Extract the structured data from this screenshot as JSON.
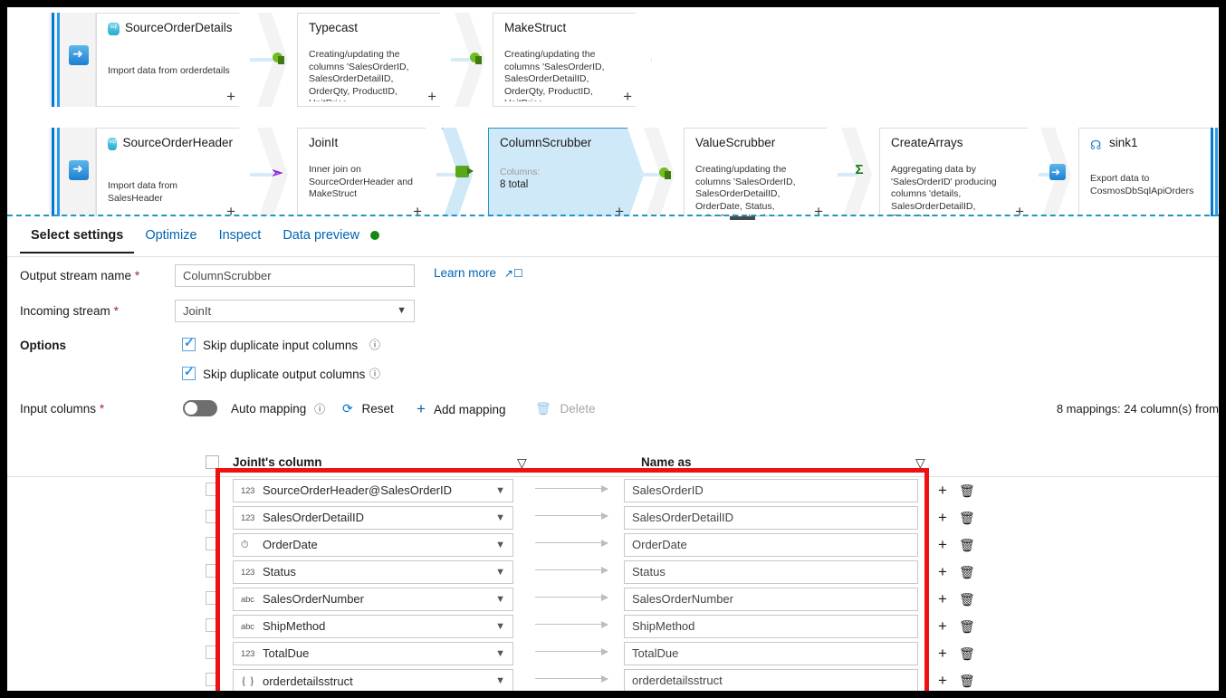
{
  "canvas": {
    "row1": [
      {
        "id": "source-order-details",
        "title": "SourceOrderDetails",
        "icon": "sql-database-icon",
        "desc": "Import data from orderdetails",
        "plus": "+"
      },
      {
        "id": "typecast",
        "title": "Typecast",
        "icon": "derived-column-icon",
        "desc": "Creating/updating the columns 'SalesOrderID, SalesOrderDetailID, OrderQty, ProductID, UnitPrice,",
        "plus": "+"
      },
      {
        "id": "make-struct",
        "title": "MakeStruct",
        "icon": "derived-column-icon",
        "desc": "Creating/updating the columns 'SalesOrderID, SalesOrderDetailID, OrderQty, ProductID, UnitPrice,",
        "plus": "+"
      }
    ],
    "row2": [
      {
        "id": "source-order-header",
        "title": "SourceOrderHeader",
        "icon": "sql-database-icon",
        "desc": "Import data from SalesHeader",
        "plus": "+"
      },
      {
        "id": "joinit",
        "title": "JoinIt",
        "icon": "join-icon",
        "desc": "Inner join on SourceOrderHeader and MakeStruct",
        "plus": "+"
      },
      {
        "id": "column-scrubber",
        "title": "ColumnScrubber",
        "icon": "select-icon",
        "label": "Columns:",
        "value": "8 total",
        "selected": true,
        "plus": "+"
      },
      {
        "id": "value-scrubber",
        "title": "ValueScrubber",
        "icon": "derived-column-icon",
        "desc": "Creating/updating the columns 'SalesOrderID, SalesOrderDetailID, OrderDate, Status, SalesOrderNumber,",
        "plus": "+"
      },
      {
        "id": "create-arrays",
        "title": "CreateArrays",
        "icon": "aggregate-icon",
        "desc": "Aggregating data by 'SalesOrderID' producing columns 'details, SalesOrderDetailID, OrderDate,",
        "plus": "+"
      },
      {
        "id": "sink1",
        "title": "sink1",
        "icon": "cosmos-db-icon",
        "desc": "Export data to CosmosDbSqlApiOrders",
        "plus": ""
      }
    ]
  },
  "tabs": [
    {
      "label": "Select settings",
      "active": true,
      "dot": false
    },
    {
      "label": "Optimize",
      "active": false,
      "dot": false
    },
    {
      "label": "Inspect",
      "active": false,
      "dot": false
    },
    {
      "label": "Data preview",
      "active": false,
      "dot": true
    }
  ],
  "form": {
    "output_stream_label": "Output stream name",
    "output_stream_value": "ColumnScrubber",
    "learn_more": "Learn more",
    "learn_more_icon": "external-link-icon",
    "incoming_stream_label": "Incoming stream",
    "incoming_stream_value": "JoinIt",
    "options_label": "Options",
    "option1": "Skip duplicate input columns",
    "option2": "Skip duplicate output columns",
    "input_columns_label": "Input columns",
    "required_marker": "*"
  },
  "toolbar": {
    "auto_mapping": "Auto mapping",
    "auto_mapping_on": false,
    "reset": "Reset",
    "add_mapping": "Add mapping",
    "delete": "Delete",
    "mapping_count": "8 mappings: 24 column(s) from"
  },
  "table": {
    "header_source": "JoinIt's column",
    "header_dest": "Name as",
    "rows": [
      {
        "type": "123",
        "source": "SourceOrderHeader@SalesOrderID",
        "dest": "SalesOrderID"
      },
      {
        "type": "123",
        "source": "SalesOrderDetailID",
        "dest": "SalesOrderDetailID"
      },
      {
        "type": "date",
        "source": "OrderDate",
        "dest": "OrderDate"
      },
      {
        "type": "123",
        "source": "Status",
        "dest": "Status"
      },
      {
        "type": "abc",
        "source": "SalesOrderNumber",
        "dest": "SalesOrderNumber"
      },
      {
        "type": "abc",
        "source": "ShipMethod",
        "dest": "ShipMethod"
      },
      {
        "type": "123",
        "source": "TotalDue",
        "dest": "TotalDue"
      },
      {
        "type": "{ }",
        "source": "orderdetailsstruct",
        "dest": "orderdetailsstruct"
      }
    ]
  },
  "colors": {
    "accent": "#0078d4",
    "selected_node": "#cfe9f9",
    "annotation": "#ee1111",
    "status_green": "#128a12",
    "required": "#a4262c"
  }
}
